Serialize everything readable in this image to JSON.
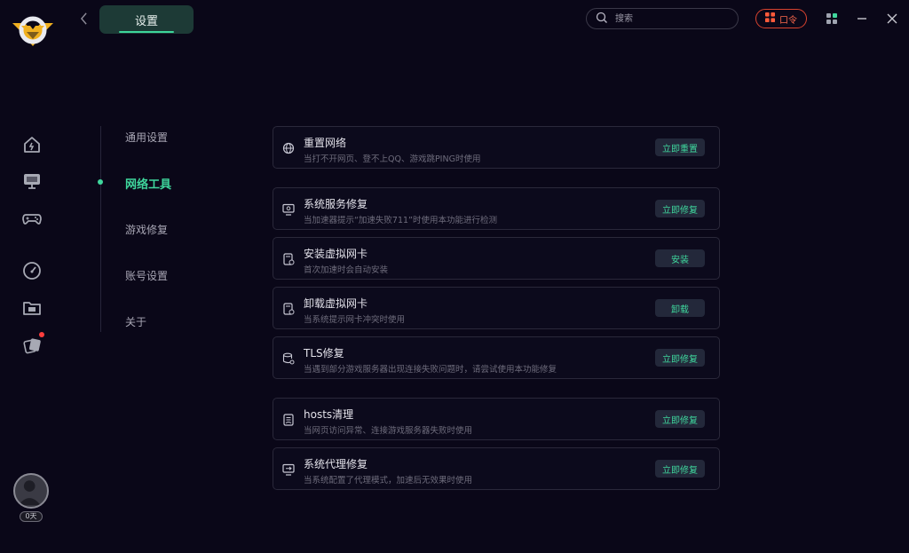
{
  "header": {
    "title": "设置",
    "back_icon": "chevron-left-icon",
    "search_placeholder": "搜索",
    "command_label": "口令",
    "accent_color": "#3fd79d"
  },
  "rail": {
    "items": [
      {
        "icon": "home-icon"
      },
      {
        "icon": "monitor-icon"
      },
      {
        "icon": "gamepad-icon"
      },
      {
        "icon": "speedometer-icon"
      },
      {
        "icon": "folder-icon"
      },
      {
        "icon": "gift-cards-icon",
        "badge": true
      }
    ],
    "user_days": "0天"
  },
  "nav": {
    "items": [
      {
        "label": "通用设置"
      },
      {
        "label": "网络工具",
        "active": true
      },
      {
        "label": "游戏修复"
      },
      {
        "label": "账号设置"
      },
      {
        "label": "关于"
      }
    ]
  },
  "tools": [
    {
      "title": "重置网络",
      "desc": "当打不开网页、登不上QQ、游戏跳PING时使用",
      "button": "立即重置",
      "icon": "globe-icon"
    },
    {
      "title": "系统服务修复",
      "desc": "当加速器提示“加速失败711”时使用本功能进行检测",
      "button": "立即修复",
      "icon": "monitor-gear-icon"
    },
    {
      "title": "安装虚拟网卡",
      "desc": "首次加速时会自动安装",
      "button": "安装",
      "icon": "network-card-icon"
    },
    {
      "title": "卸载虚拟网卡",
      "desc": "当系统提示网卡冲突时使用",
      "button": "卸载",
      "icon": "network-card-icon"
    },
    {
      "title": "TLS修复",
      "desc": "当遇到部分游戏服务器出现连接失败问题时，请尝试使用本功能修复",
      "button": "立即修复",
      "icon": "database-gear-icon"
    },
    {
      "title": "hosts清理",
      "desc": "当网页访问异常、连接游戏服务器失败时使用",
      "button": "立即修复",
      "icon": "document-refresh-icon"
    },
    {
      "title": "系统代理修复",
      "desc": "当系统配置了代理模式，加速后无效果时使用",
      "button": "立即修复",
      "icon": "monitor-proxy-icon"
    }
  ]
}
